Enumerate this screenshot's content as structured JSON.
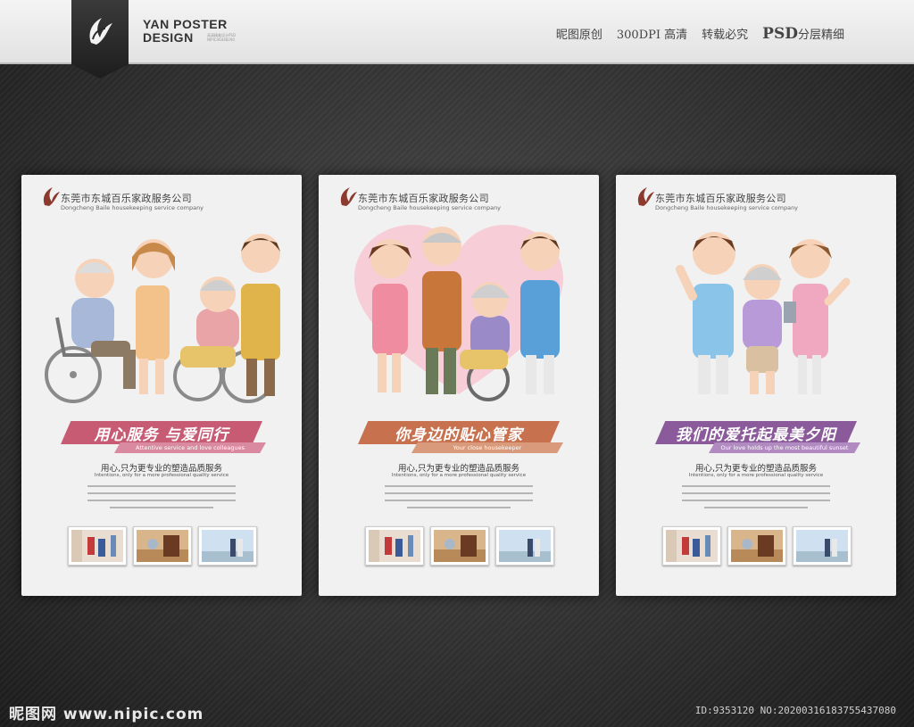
{
  "header": {
    "brand_title_1": "YAN POSTER",
    "brand_title_2": "DESIGN",
    "brand_sub": "高清精美设计PSD NIPIC46448290",
    "tags": [
      "昵图原创",
      "300DPI 高清",
      "转载必究"
    ],
    "psd_label": "PSD",
    "psd_suffix": "分层精细"
  },
  "company": {
    "name_cn": "东莞市东城百乐家政服务公司",
    "name_en": "Dongcheng Baile housekeeping service company"
  },
  "posters": [
    {
      "title_cn": "用心服务 与爱同行",
      "title_en": "Attentive service and love colleagues",
      "slogan_cn": "用心,只为更专业的塑造品质服务",
      "slogan_en": "Intentions, only for a more professional quality service",
      "accent": "#c85b74"
    },
    {
      "title_cn": "你身边的贴心管家",
      "title_en": "Your close housekeeper",
      "slogan_cn": "用心,只为更专业的塑造品质服务",
      "slogan_en": "Intentions, only for a more professional quality service",
      "accent": "#c8714e"
    },
    {
      "title_cn": "我们的爱托起最美夕阳",
      "title_en": "Our love holds up the most beautiful sunset",
      "slogan_cn": "用心,只为更专业的塑造品质服务",
      "slogan_en": "Intentions, only for a more professional quality service",
      "accent": "#8a5a9a"
    }
  ],
  "footer": {
    "watermark": "昵图网 www.nipic.com",
    "image_id": "ID:9353120 NO:20200316183755437080"
  },
  "icons": [
    "yan-logo-icon",
    "company-logo-icon"
  ]
}
